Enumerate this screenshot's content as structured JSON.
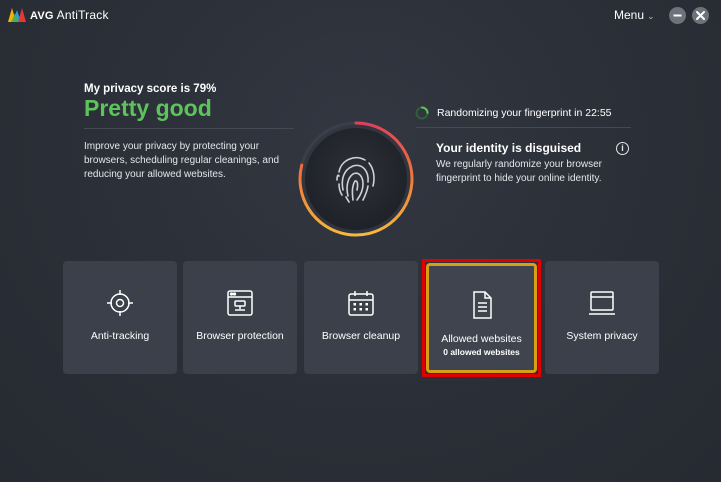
{
  "app": {
    "brand": "AVG",
    "product": "AntiTrack",
    "menu_label": "Menu"
  },
  "privacy": {
    "score_label": "My privacy score is 79%",
    "score_value": 79,
    "status": "Pretty good",
    "description": "Improve your privacy by protecting your browsers, scheduling regular cleanings, and reducing your allowed websites."
  },
  "fingerprint": {
    "randomizing_text": "Randomizing your fingerprint in 22:55",
    "identity_title": "Your identity is disguised",
    "identity_desc": "We regularly randomize your browser fingerprint to hide your online identity."
  },
  "tiles": [
    {
      "label": "Anti-tracking",
      "icon": "crosshair-icon"
    },
    {
      "label": "Browser protection",
      "icon": "browser-shield-icon"
    },
    {
      "label": "Browser cleanup",
      "icon": "calendar-icon"
    },
    {
      "label": "Allowed websites",
      "sublabel": "0 allowed websites",
      "icon": "document-icon"
    },
    {
      "label": "System privacy",
      "icon": "monitor-icon"
    }
  ],
  "colors": {
    "status_green": "#5dc35b",
    "highlight_red": "#e00000",
    "tile_bg": "#3b404a",
    "background": "#2b2f37"
  }
}
